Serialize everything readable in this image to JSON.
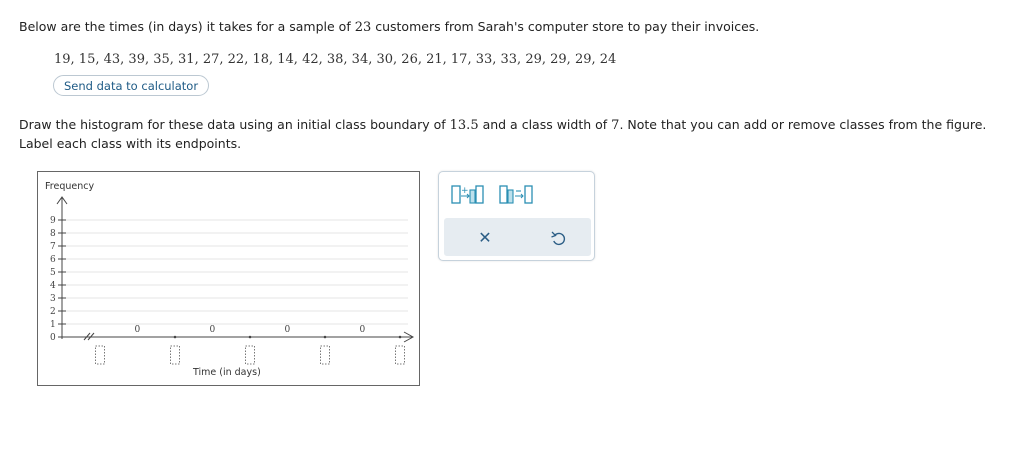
{
  "problem": {
    "intro_before": "Below are the times (in days) it takes for a sample of ",
    "sample_size": "23",
    "intro_after": " customers from Sarah's computer store to pay their invoices.",
    "data_values": "19, 15, 43, 39, 35, 31, 27, 22, 18, 14, 42, 38, 34, 30, 26, 21, 17, 33, 33, 29, 29, 29, 24",
    "calculator_button": "Send data to calculator",
    "instr_1": "Draw the histogram for these data using an initial class boundary of ",
    "boundary": "13.5",
    "instr_2": " and a class width of ",
    "width": "7",
    "instr_3": ". Note that you can add or remove classes from the figure. Label each class with its endpoints."
  },
  "graph": {
    "y_label": "Frequency",
    "x_label": "Time (in days)",
    "y_ticks": [
      "0",
      "1",
      "2",
      "3",
      "4",
      "5",
      "6",
      "7",
      "8",
      "9"
    ],
    "bar_values": [
      "0",
      "0",
      "0",
      "0"
    ],
    "endpoint_inputs": [
      "",
      "",
      "",
      "",
      ""
    ]
  },
  "chart_data": {
    "type": "bar",
    "categories": [
      "",
      "",
      "",
      ""
    ],
    "values": [
      0,
      0,
      0,
      0
    ],
    "title": "",
    "xlabel": "Time (in days)",
    "ylabel": "Frequency",
    "ylim": [
      0,
      9
    ],
    "grid": true
  },
  "toolbar": {
    "add_class_icon": "add-class-icon",
    "remove_class_icon": "remove-class-icon",
    "clear_icon": "close-icon",
    "undo_icon": "undo-icon",
    "accent": "#2b8fb3"
  }
}
